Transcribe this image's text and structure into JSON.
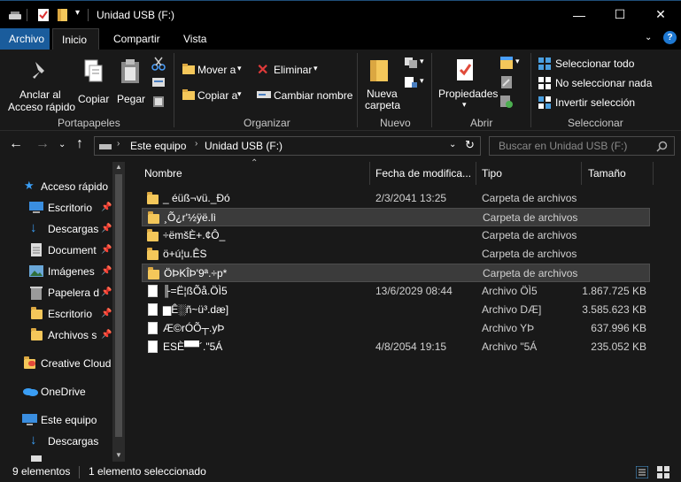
{
  "window": {
    "title": "Unidad USB (F:)",
    "minimize": "—",
    "maximize": "☐",
    "close": "✕"
  },
  "ribbon_tabs": [
    "Archivo",
    "Inicio",
    "Compartir",
    "Vista"
  ],
  "ribbon": {
    "portapapeles": {
      "group_label": "Portapapeles",
      "pin_label_1": "Anclar al",
      "pin_label_2": "Acceso rápido",
      "copy": "Copiar",
      "paste": "Pegar"
    },
    "organizar": {
      "group_label": "Organizar",
      "move_to": "Mover a",
      "copy_to": "Copiar a",
      "delete": "Eliminar",
      "rename": "Cambiar nombre"
    },
    "nuevo": {
      "group_label": "Nuevo",
      "new_folder_1": "Nueva",
      "new_folder_2": "carpeta"
    },
    "abrir": {
      "group_label": "Abrir",
      "properties": "Propiedades"
    },
    "seleccionar": {
      "group_label": "Seleccionar",
      "select_all": "Seleccionar todo",
      "select_none": "No seleccionar nada",
      "invert": "Invertir selección"
    }
  },
  "address": {
    "crumbs": [
      "Este equipo",
      "Unidad USB (F:)"
    ],
    "search_placeholder": "Buscar en Unidad USB (F:)"
  },
  "nav": {
    "quick_access": "Acceso rápido",
    "items": [
      {
        "label": "Escritorio",
        "icon": "desktop-icon",
        "pinned": true
      },
      {
        "label": "Descargas",
        "icon": "download-icon",
        "pinned": true
      },
      {
        "label": "Document",
        "icon": "document-icon",
        "pinned": true
      },
      {
        "label": "Imágenes",
        "icon": "pictures-icon",
        "pinned": true
      },
      {
        "label": "Papelera d",
        "icon": "recycle-bin-icon",
        "pinned": true
      },
      {
        "label": "Escritorio",
        "icon": "folder-icon",
        "pinned": true
      },
      {
        "label": "Archivos s",
        "icon": "folder-icon",
        "pinned": true
      }
    ],
    "creative_cloud": "Creative Cloud",
    "onedrive": "OneDrive",
    "this_pc": "Este equipo",
    "pc_downloads": "Descargas"
  },
  "columns": [
    "Nombre",
    "Fecha de modifica...",
    "Tipo",
    "Tamaño"
  ],
  "files": [
    {
      "name": "_ éüß¬vü._Ðó",
      "date": "2/3/2041 13:25",
      "type": "Carpeta de archivos",
      "size": "",
      "kind": "folder",
      "selected": false
    },
    {
      "name": "¸Õ¿r'½ÿë.lì",
      "date": "",
      "type": "Carpeta de archivos",
      "size": "",
      "kind": "folder",
      "selected": true
    },
    {
      "name": "÷ëmšÈ+.¢Ô_",
      "date": "",
      "type": "Carpeta de archivos",
      "size": "",
      "kind": "folder",
      "selected": false
    },
    {
      "name": "ö+ú¦u.ÊS",
      "date": "",
      "type": "Carpeta de archivos",
      "size": "",
      "kind": "folder",
      "selected": false
    },
    {
      "name": "ÖÞKÎÞ'9ª.÷p*",
      "date": "",
      "type": "Carpeta de archivos",
      "size": "",
      "kind": "folder",
      "selected": true
    },
    {
      "name": "╟=Ë¦ßÕå.ÖÌ5",
      "date": "13/6/2029 08:44",
      "type": "Archivo ÖÌ5",
      "size": "1.867.725 KB",
      "kind": "file",
      "selected": false
    },
    {
      "name": "▆Ê░ñ~ü³.dæ]",
      "date": "",
      "type": "Archivo DÆ]",
      "size": "3.585.623 KB",
      "kind": "file",
      "selected": false
    },
    {
      "name": "Æ©rÓÕ┬.yÞ",
      "date": "",
      "type": "Archivo YÞ",
      "size": "637.996 KB",
      "kind": "file",
      "selected": false
    },
    {
      "name": "ESÈ▀▀´.\"5Á",
      "date": "4/8/2054 19:15",
      "type": "Archivo \"5Á",
      "size": "235.052 KB",
      "kind": "file",
      "selected": false
    }
  ],
  "status": {
    "count": "9 elementos",
    "selection": "1 elemento seleccionado"
  },
  "colors": {
    "accent": "#1a5c9c",
    "background": "#191919",
    "folder": "#f4c75a",
    "selected_row": "#3b3b3b"
  }
}
